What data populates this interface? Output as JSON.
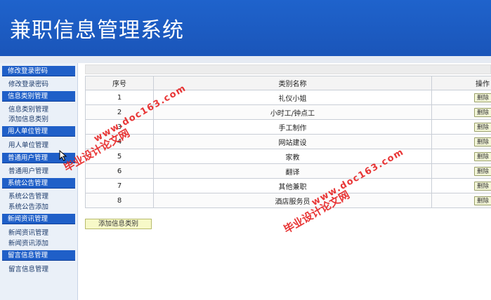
{
  "header": {
    "title": "兼职信息管理系统"
  },
  "sidebar": {
    "sections": [
      {
        "head": "修改登录密码",
        "items": [
          "修改登录密码"
        ]
      },
      {
        "head": "信息类别管理",
        "items": [
          "信息类别管理",
          "添加信息类别"
        ]
      },
      {
        "head": "用人单位管理",
        "items": [
          "用人单位管理"
        ]
      },
      {
        "head": "普通用户管理",
        "items": [
          "普通用户管理"
        ]
      },
      {
        "head": "系统公告管理",
        "items": [
          "系统公告管理",
          "系统公告添加"
        ]
      },
      {
        "head": "新闻资讯管理",
        "items": [
          "新闻资讯管理",
          "新闻资讯添加"
        ]
      },
      {
        "head": "留言信息管理",
        "items": [
          "留言信息管理"
        ]
      }
    ]
  },
  "table": {
    "headers": [
      "序号",
      "类别名称",
      "操作"
    ],
    "rows": [
      {
        "no": "1",
        "name": "礼仪小姐",
        "action": "删除"
      },
      {
        "no": "2",
        "name": "小时工/钟点工",
        "action": "删除"
      },
      {
        "no": "3",
        "name": "手工制作",
        "action": "删除"
      },
      {
        "no": "4",
        "name": "网站建设",
        "action": "删除"
      },
      {
        "no": "5",
        "name": "家教",
        "action": "删除"
      },
      {
        "no": "6",
        "name": "翻译",
        "action": "删除"
      },
      {
        "no": "7",
        "name": "其他兼职",
        "action": "删除"
      },
      {
        "no": "8",
        "name": "酒店服务员",
        "action": "删除"
      }
    ]
  },
  "add_button": "添加信息类别",
  "watermark": {
    "line1": "毕业设计论文网",
    "line2": "www.doc163.com"
  },
  "colors": {
    "header_blue": "#1f63cc",
    "section_blue": "#1f5fc8",
    "watermark_red": "#e62020",
    "button_yellow": "#f3f6d7"
  }
}
